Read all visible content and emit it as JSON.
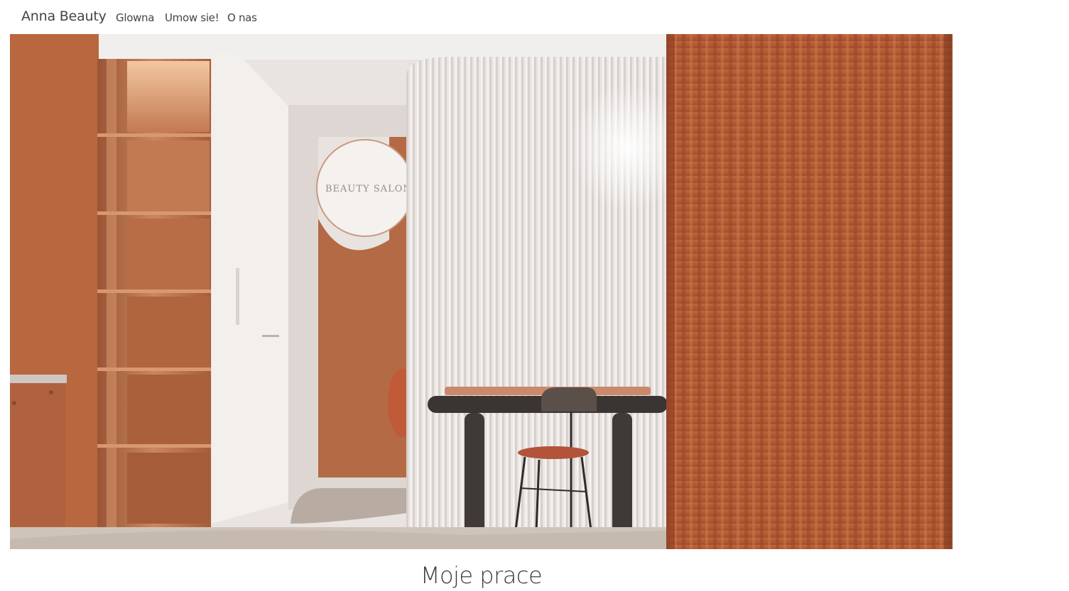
{
  "navbar": {
    "brand": "Anna Beauty",
    "items": [
      {
        "label": "Glowna"
      },
      {
        "label": "Umow sie!"
      },
      {
        "label": "O nas"
      }
    ]
  },
  "hero": {
    "sign_text": "BEAUTY SALON",
    "colors": {
      "terracotta": "#b8673f",
      "curtain": "#b45a34",
      "wall_white": "#ece8e6",
      "desk_dark": "#3a3533",
      "floor": "#cfc4ba"
    }
  },
  "main": {
    "section_title": "Moje prace"
  }
}
